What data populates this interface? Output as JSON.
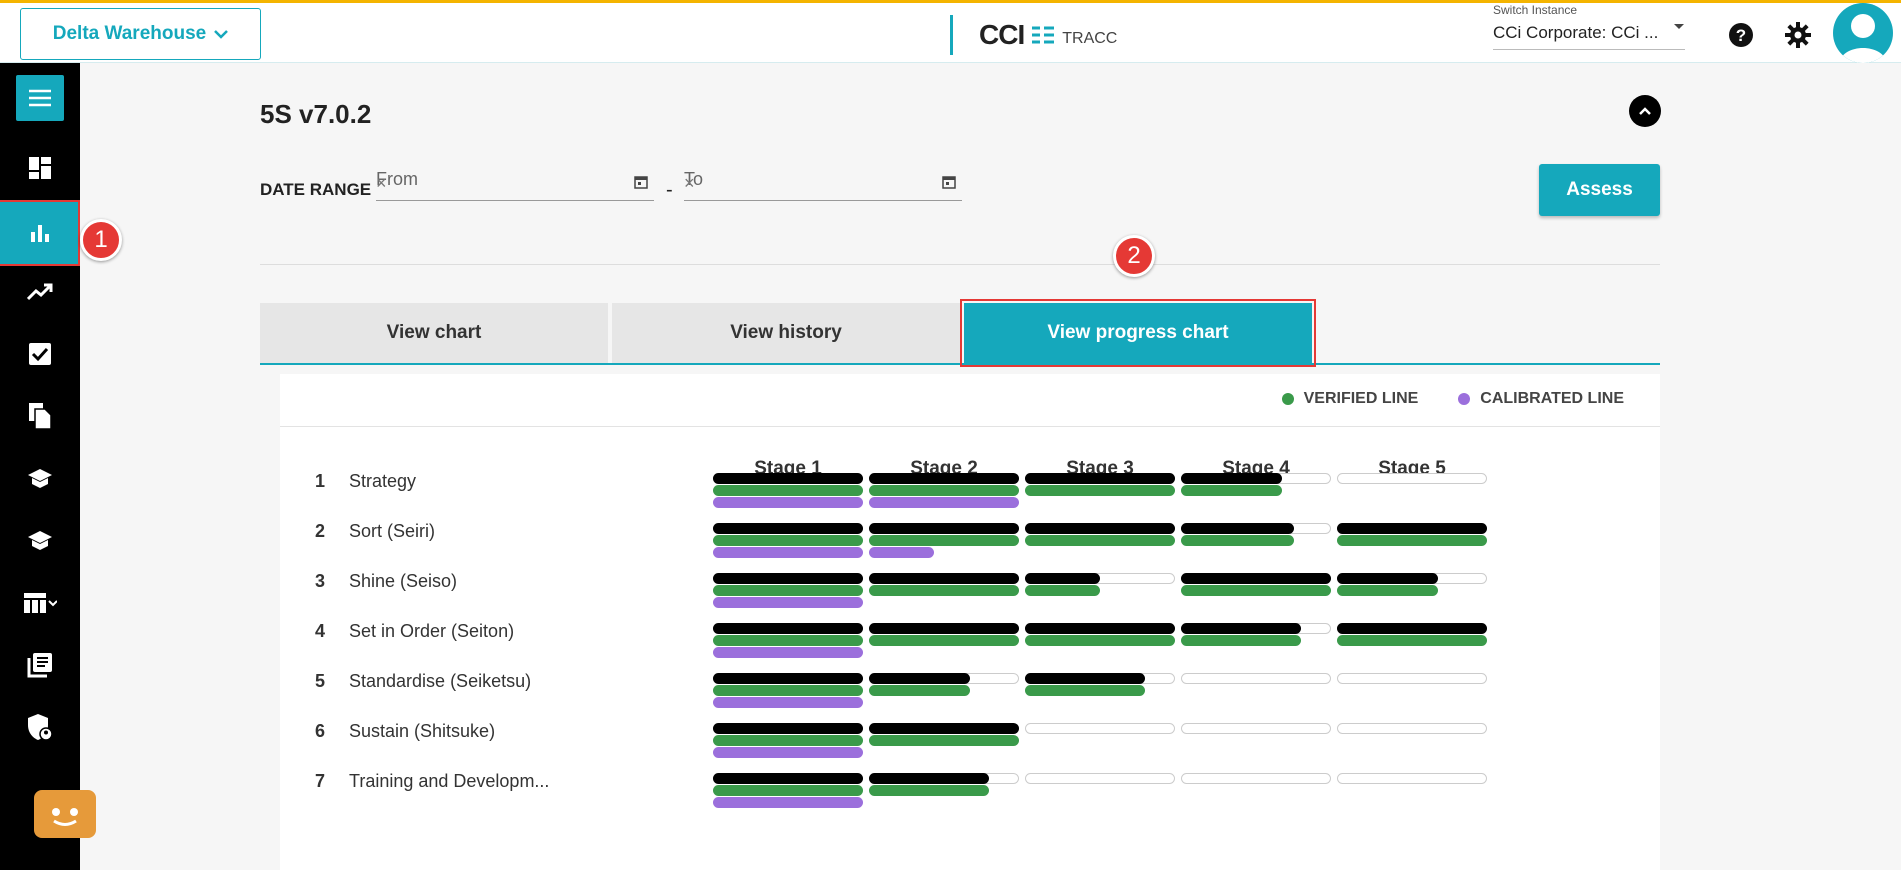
{
  "header": {
    "workspace": "Delta Warehouse",
    "logo_main": "CCI",
    "logo_sub": "TRACC",
    "switch_label": "Switch Instance",
    "switch_value": "CCi Corporate: CCi ..."
  },
  "annotations": {
    "badge1": "1",
    "badge2": "2"
  },
  "page": {
    "title": "5S v7.0.2",
    "date_range_label": "DATE RANGE",
    "from_placeholder": "From",
    "to_placeholder": "To",
    "dash": "-",
    "assess_label": "Assess",
    "clear_glyph": "×"
  },
  "tabs": [
    {
      "label": "View chart"
    },
    {
      "label": "View history"
    },
    {
      "label": "View progress chart"
    }
  ],
  "legend": [
    {
      "label": "VERIFIED LINE",
      "color": "#3a9a4a"
    },
    {
      "label": "CALIBRATED LINE",
      "color": "#9b6fdc"
    }
  ],
  "colors": {
    "accent": "#15a8bc",
    "black_line": "#000000",
    "verified": "#3a9a4a",
    "calibrated": "#9b6fdc"
  },
  "stages": [
    "Stage 1",
    "Stage 2",
    "Stage 3",
    "Stage 4",
    "Stage 5"
  ],
  "rows": [
    {
      "num": "1",
      "name": "Strategy",
      "cells": [
        [
          1,
          1,
          1
        ],
        [
          1,
          1,
          1
        ],
        [
          1,
          1,
          0
        ],
        [
          0.67,
          0.67,
          0
        ],
        [
          0,
          0,
          0
        ]
      ]
    },
    {
      "num": "2",
      "name": "Sort (Seiri)",
      "cells": [
        [
          1,
          1,
          1
        ],
        [
          1,
          1,
          0.43
        ],
        [
          1,
          1,
          0
        ],
        [
          0.75,
          0.75,
          0
        ],
        [
          1,
          1,
          0
        ]
      ]
    },
    {
      "num": "3",
      "name": "Shine (Seiso)",
      "cells": [
        [
          1,
          1,
          1
        ],
        [
          1,
          1,
          0
        ],
        [
          0.5,
          0.5,
          0
        ],
        [
          1,
          1,
          0
        ],
        [
          0.67,
          0.67,
          0
        ]
      ]
    },
    {
      "num": "4",
      "name": "Set in Order (Seiton)",
      "cells": [
        [
          1,
          1,
          1
        ],
        [
          1,
          1,
          0
        ],
        [
          1,
          1,
          0
        ],
        [
          0.8,
          0.8,
          0
        ],
        [
          1,
          1,
          0
        ]
      ]
    },
    {
      "num": "5",
      "name": "Standardise (Seiketsu)",
      "cells": [
        [
          1,
          1,
          1
        ],
        [
          0.67,
          0.67,
          0
        ],
        [
          0.8,
          0.8,
          0
        ],
        [
          0,
          0,
          0
        ],
        [
          0,
          0,
          0
        ]
      ]
    },
    {
      "num": "6",
      "name": "Sustain (Shitsuke)",
      "cells": [
        [
          1,
          1,
          1
        ],
        [
          1,
          1,
          0
        ],
        [
          0,
          0,
          0
        ],
        [
          0,
          0,
          0
        ],
        [
          0,
          0,
          0
        ]
      ]
    },
    {
      "num": "7",
      "name": "Training and Developm...",
      "cells": [
        [
          1,
          1,
          1
        ],
        [
          0.8,
          0.8,
          0
        ],
        [
          0,
          0,
          0
        ],
        [
          0,
          0,
          0
        ],
        [
          0,
          0,
          0
        ]
      ]
    }
  ]
}
